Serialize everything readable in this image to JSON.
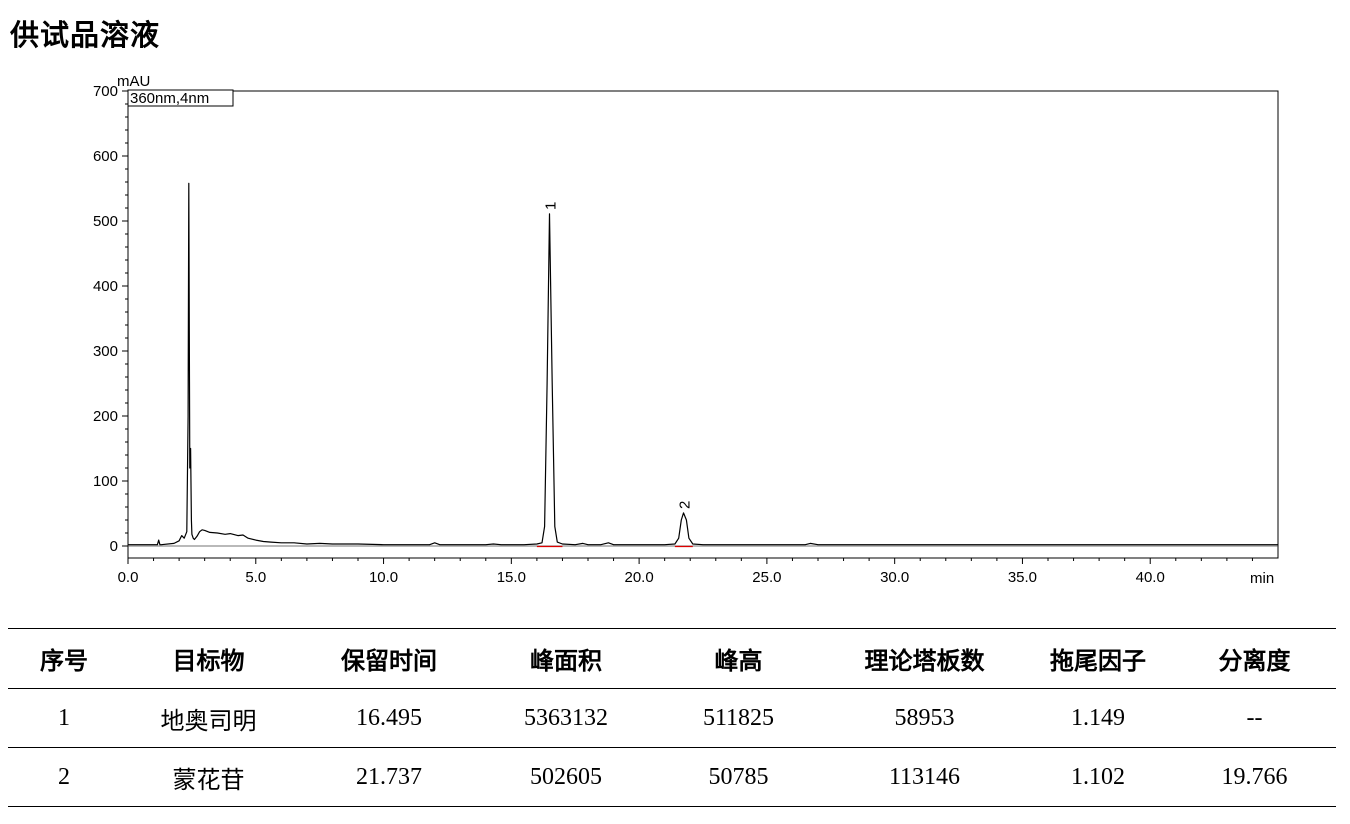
{
  "title": "供试品溶液",
  "chart_data": {
    "type": "line",
    "ylabel": "mAU",
    "xlabel": "min",
    "legend": "360nm,4nm",
    "xlim": [
      0,
      45
    ],
    "ylim": [
      0,
      700
    ],
    "x_ticks": [
      "0.0",
      "5.0",
      "10.0",
      "15.0",
      "20.0",
      "25.0",
      "30.0",
      "35.0",
      "40.0"
    ],
    "y_ticks": [
      "0",
      "100",
      "200",
      "300",
      "400",
      "500",
      "600",
      "700"
    ],
    "peak_labels": [
      {
        "label": "1",
        "x": 16.495,
        "y": 511
      },
      {
        "label": "2",
        "x": 21.737,
        "y": 51
      }
    ],
    "series": [
      {
        "x": [
          0.0,
          1.0,
          1.15,
          1.2,
          1.25,
          1.3,
          1.8,
          2.0,
          2.1,
          2.2,
          2.3,
          2.35,
          2.38,
          2.4,
          2.42,
          2.45,
          2.48,
          2.5,
          2.55,
          2.6,
          2.7,
          2.8,
          2.9,
          3.0,
          3.2,
          3.5,
          3.8,
          4.0,
          4.3,
          4.5,
          4.7,
          5.0,
          5.3,
          5.6,
          6.0,
          6.5,
          7.0,
          7.5,
          8.0,
          8.5,
          9.0,
          10.0,
          11.0,
          11.8,
          12.0,
          12.2,
          13.0,
          14.0,
          14.3,
          14.6,
          15.0,
          15.5,
          16.0,
          16.2,
          16.3,
          16.4,
          16.495,
          16.6,
          16.7,
          16.8,
          17.0,
          17.5,
          17.8,
          18.0,
          18.5,
          18.8,
          19.0,
          20.0,
          21.0,
          21.4,
          21.55,
          21.65,
          21.737,
          21.85,
          21.95,
          22.1,
          22.5,
          22.9,
          23.5,
          24.0,
          25.0,
          26.0,
          26.5,
          26.7,
          27.0,
          30.0,
          35.0,
          40.0,
          45.0
        ],
        "y": [
          2,
          2,
          2,
          9,
          2,
          2,
          4,
          8,
          16,
          12,
          22,
          200,
          558,
          330,
          120,
          150,
          40,
          18,
          12,
          10,
          15,
          22,
          25,
          24,
          21,
          20,
          18,
          19,
          16,
          17,
          12,
          9,
          7,
          6,
          5,
          5,
          3,
          4,
          3,
          3,
          3,
          2,
          2,
          2,
          5,
          2,
          2,
          2,
          3,
          2,
          2,
          2,
          3,
          5,
          30,
          250,
          511,
          250,
          30,
          6,
          3,
          2,
          4,
          2,
          2,
          5,
          2,
          2,
          2,
          3,
          12,
          40,
          51,
          40,
          12,
          3,
          2,
          2,
          2,
          2,
          2,
          2,
          2,
          4,
          2,
          2,
          2,
          2,
          2
        ]
      }
    ]
  },
  "table": {
    "headers": [
      "序号",
      "目标物",
      "保留时间",
      "峰面积",
      "峰高",
      "理论塔板数",
      "拖尾因子",
      "分离度"
    ],
    "rows": [
      [
        "1",
        "地奥司明",
        "16.495",
        "5363132",
        "511825",
        "58953",
        "1.149",
        "--"
      ],
      [
        "2",
        "蒙花苷",
        "21.737",
        "502605",
        "50785",
        "113146",
        "1.102",
        "19.766"
      ]
    ]
  }
}
